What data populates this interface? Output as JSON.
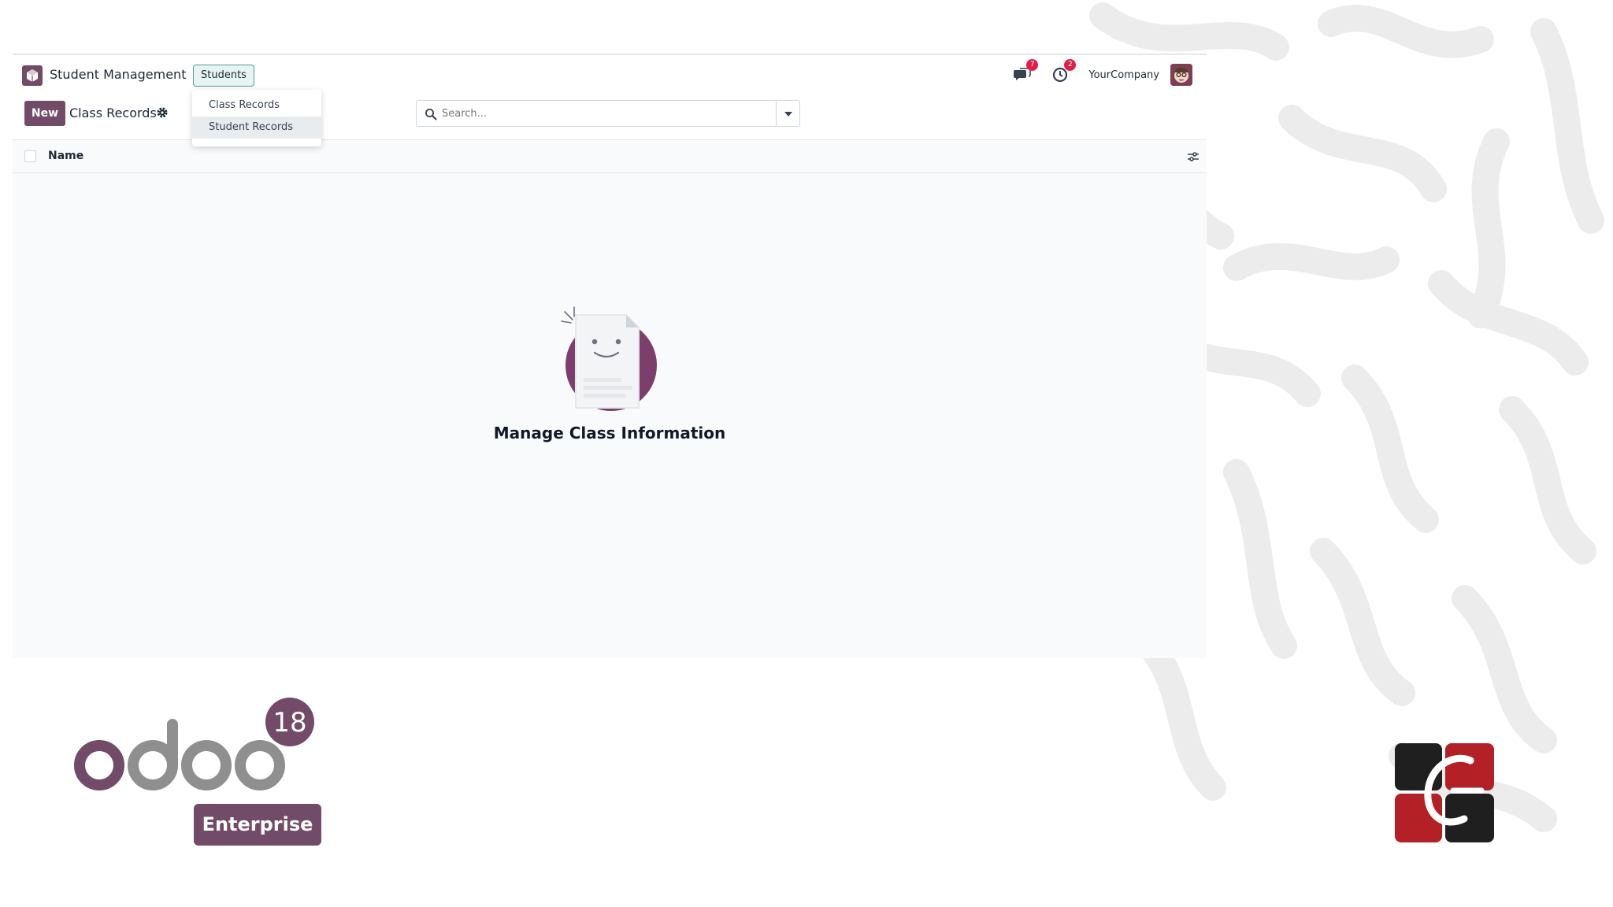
{
  "navbar": {
    "app_name": "Student Management",
    "menu_label": "Students",
    "messages_count": "7",
    "activities_count": "2",
    "company": "YourCompany"
  },
  "dropdown": {
    "items": [
      "Class Records",
      "Student Records"
    ],
    "active_index": 1
  },
  "control": {
    "new_label": "New",
    "breadcrumb": "Class Records",
    "search_placeholder": "Search..."
  },
  "list": {
    "columns": [
      "Name"
    ]
  },
  "empty_state": {
    "title": "Manage Class Information"
  },
  "branding": {
    "version": "18",
    "edition": "Enterprise"
  },
  "colors": {
    "brand": "#714b67",
    "badge": "#e11d48",
    "menu_active_border": "#5a9a97"
  }
}
